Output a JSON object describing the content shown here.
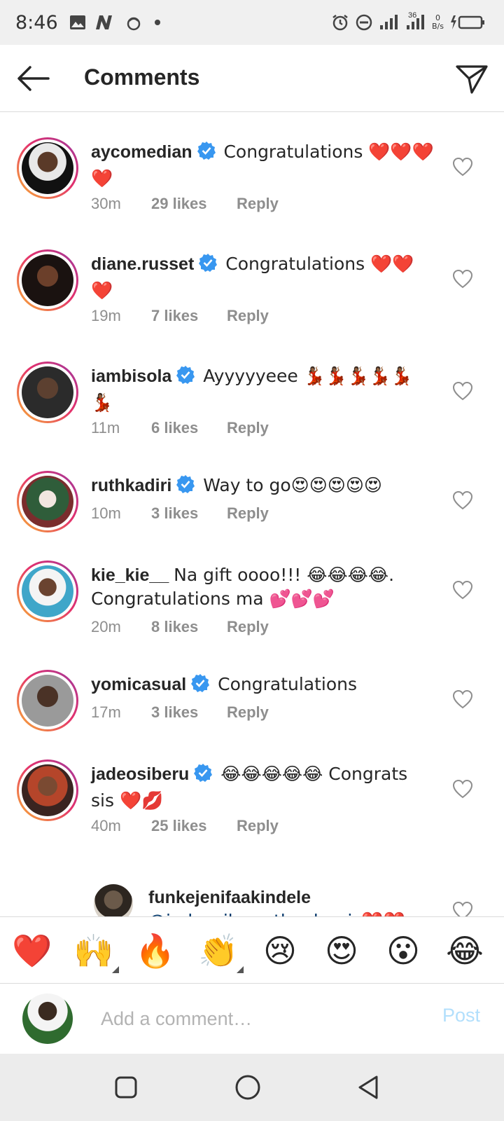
{
  "status_bar": {
    "time": "8:46",
    "signal_label": "36",
    "net_speed_value": "0",
    "net_speed_unit": "B/s"
  },
  "header": {
    "title": "Comments",
    "back_icon": "arrow-left-icon",
    "send_icon": "send-direct-icon"
  },
  "comments": [
    {
      "username": "aycomedian",
      "verified": true,
      "text": "Congratulations ❤️❤️❤️❤️",
      "time": "30m",
      "likes": "29 likes",
      "reply": "Reply"
    },
    {
      "username": "diane.russet",
      "verified": true,
      "text": "Congratulations ❤️❤️❤️",
      "time": "19m",
      "likes": "7 likes",
      "reply": "Reply"
    },
    {
      "username": "iambisola",
      "verified": true,
      "text": "Ayyyyyeee 💃🏾💃🏾💃🏾💃🏾💃🏾💃🏾",
      "time": "11m",
      "likes": "6 likes",
      "reply": "Reply"
    },
    {
      "username": "ruthkadiri",
      "verified": true,
      "text": "Way to go😍😍😍😍😍",
      "time": "10m",
      "likes": "3 likes",
      "reply": "Reply"
    },
    {
      "username": "kie_kie__",
      "verified": false,
      "text": "Na gift oooo!!! 😂😂😂😂. Congratulations ma 💕💕💕",
      "time": "20m",
      "likes": "8 likes",
      "reply": "Reply"
    },
    {
      "username": "yomicasual",
      "verified": true,
      "text": "Congratulations",
      "time": "17m",
      "likes": "3 likes",
      "reply": "Reply"
    },
    {
      "username": "jadeosiberu",
      "verified": true,
      "text": "😂😂😂😂😂 Congrats sis ❤️💋",
      "time": "40m",
      "likes": "25 likes",
      "reply": "Reply"
    }
  ],
  "reply_preview": {
    "username": "funkejenifaakindele",
    "text": "@jadeosiberu thanks sis❤️❤️"
  },
  "emoji_bar": [
    "❤️",
    "🙌",
    "🔥",
    "👏",
    "😢",
    "😍",
    "😮",
    "😂"
  ],
  "add_comment": {
    "placeholder": "Add a comment…",
    "post_label": "Post"
  },
  "colors": {
    "accent_blue": "#3897f0",
    "post_disabled": "#b2dffc",
    "meta_gray": "#8e8e8e"
  }
}
